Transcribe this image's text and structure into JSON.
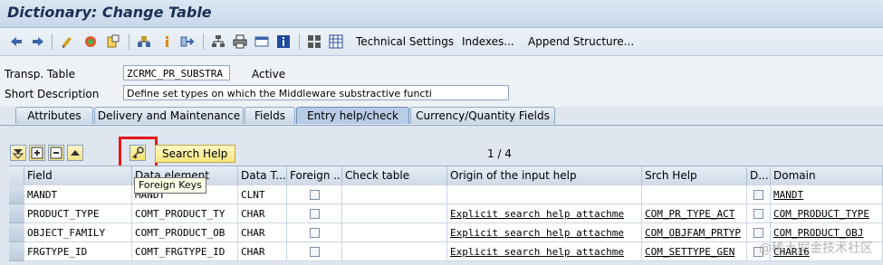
{
  "window": {
    "title": "Dictionary: Change Table"
  },
  "toolbar": {
    "technical_settings": "Technical Settings",
    "indexes": "Indexes...",
    "append_structure": "Append Structure..."
  },
  "header": {
    "transp_table_label": "Transp. Table",
    "transp_table_value": "ZCRMC_PR_SUBSTRA",
    "status": "Active",
    "short_desc_label": "Short Description",
    "short_desc_value": "Define set types on which the Middleware substractive functi"
  },
  "tabs": [
    {
      "label": "Attributes"
    },
    {
      "label": "Delivery and Maintenance"
    },
    {
      "label": "Fields"
    },
    {
      "label": "Entry help/check"
    },
    {
      "label": "Currency/Quantity Fields"
    }
  ],
  "grid_toolbar": {
    "search_help_label": "Search Help",
    "pager": "1 / 4",
    "tooltip": "Foreign Keys"
  },
  "table": {
    "columns": [
      "Field",
      "Data element",
      "Data T...",
      "Foreign ...",
      "Check table",
      "Origin of the input help",
      "Srch Help",
      "D...",
      "Domain"
    ],
    "rows": [
      {
        "field": "MANDT",
        "data_element": "MANDT",
        "data_type": "CLNT",
        "check_table": "",
        "origin": "",
        "srch_help": "",
        "domain": "MANDT"
      },
      {
        "field": "PRODUCT_TYPE",
        "data_element": "COMT_PRODUCT_TY",
        "data_type": "CHAR",
        "check_table": "",
        "origin": "Explicit search help attachme",
        "srch_help": "COM_PR_TYPE_ACT",
        "domain": "COM_PRODUCT_TYPE"
      },
      {
        "field": "OBJECT_FAMILY",
        "data_element": "COMT_PRODUCT_OB",
        "data_type": "CHAR",
        "check_table": "",
        "origin": "Explicit search help attachme",
        "srch_help": "COM_OBJFAM_PRTYP",
        "domain": "COM_PRODUCT_OBJ"
      },
      {
        "field": "FRGTYPE_ID",
        "data_element": "COMT_FRGTYPE_ID",
        "data_type": "CHAR",
        "check_table": "",
        "origin": "Explicit search help attachme",
        "srch_help": "COM_SETTYPE_GEN",
        "domain": "CHAR16"
      }
    ]
  },
  "watermark": "@稀土掘金技术社区",
  "icons": [
    "back-icon",
    "forward-icon",
    "check-icon",
    "activate-icon",
    "other-object-icon",
    "where-used-icon",
    "info-icon",
    "navigate-icon",
    "hierarchy-icon",
    "print-icon",
    "display-icon",
    "info-button-icon",
    "layout-icon",
    "table-icon"
  ]
}
